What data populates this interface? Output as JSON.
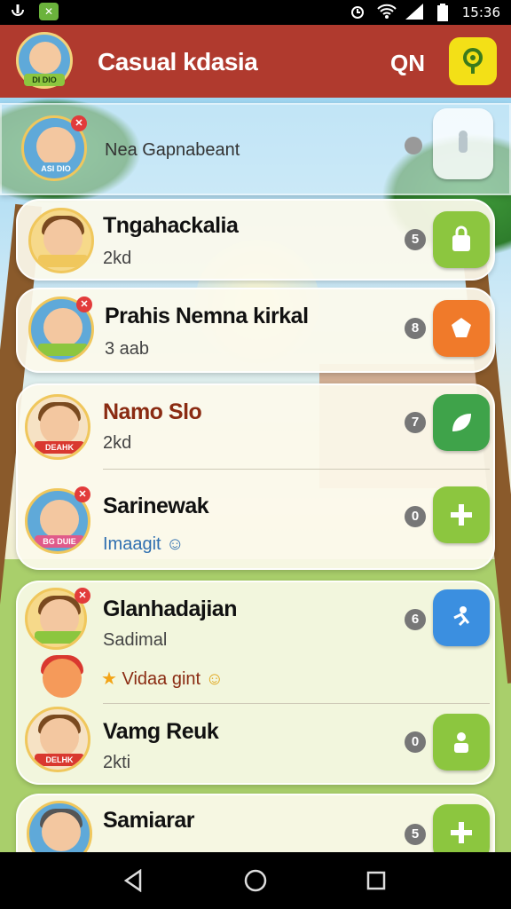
{
  "status_bar": {
    "time": "15:36"
  },
  "app_bar": {
    "title": "Casual kdasia",
    "search_label": "QN",
    "avatar_tag": "DI DIO"
  },
  "header_row": {
    "label": "Nea Gapnabeant",
    "avatar_tag": "ASI DIO"
  },
  "contacts": [
    {
      "name": "Tngahackalia",
      "sub": "2kd",
      "count": "5",
      "tag": "",
      "accent": "#8cc63f"
    },
    {
      "name": "Prahis Nemna kirkal",
      "sub": "3 aab",
      "count": "8",
      "tag": "",
      "accent": "#f07a2a"
    },
    {
      "name": "Namo Slo",
      "sub": "2kd",
      "count": "7",
      "tag": "DEAHK",
      "accent": "#3fa34a"
    },
    {
      "name": "Sarinewak",
      "sub": "Imaagit",
      "count": "0",
      "tag": "BG DUIE",
      "accent": "#8cc63f"
    },
    {
      "name": "Glanhadajian",
      "sub": "Sadimal",
      "sub2": "Vidaa gint",
      "count": "6",
      "tag": "",
      "accent": "#3b8fe0"
    },
    {
      "name": "Vamg Reuk",
      "sub": "2kti",
      "count": "0",
      "tag": "DELHK",
      "accent": "#8cc63f"
    },
    {
      "name": "Samiarar",
      "sub": "",
      "count": "5",
      "tag": "",
      "accent": "#8cc63f"
    }
  ],
  "colors": {
    "app_bar": "#b03a2e",
    "action": "#f3e017"
  }
}
